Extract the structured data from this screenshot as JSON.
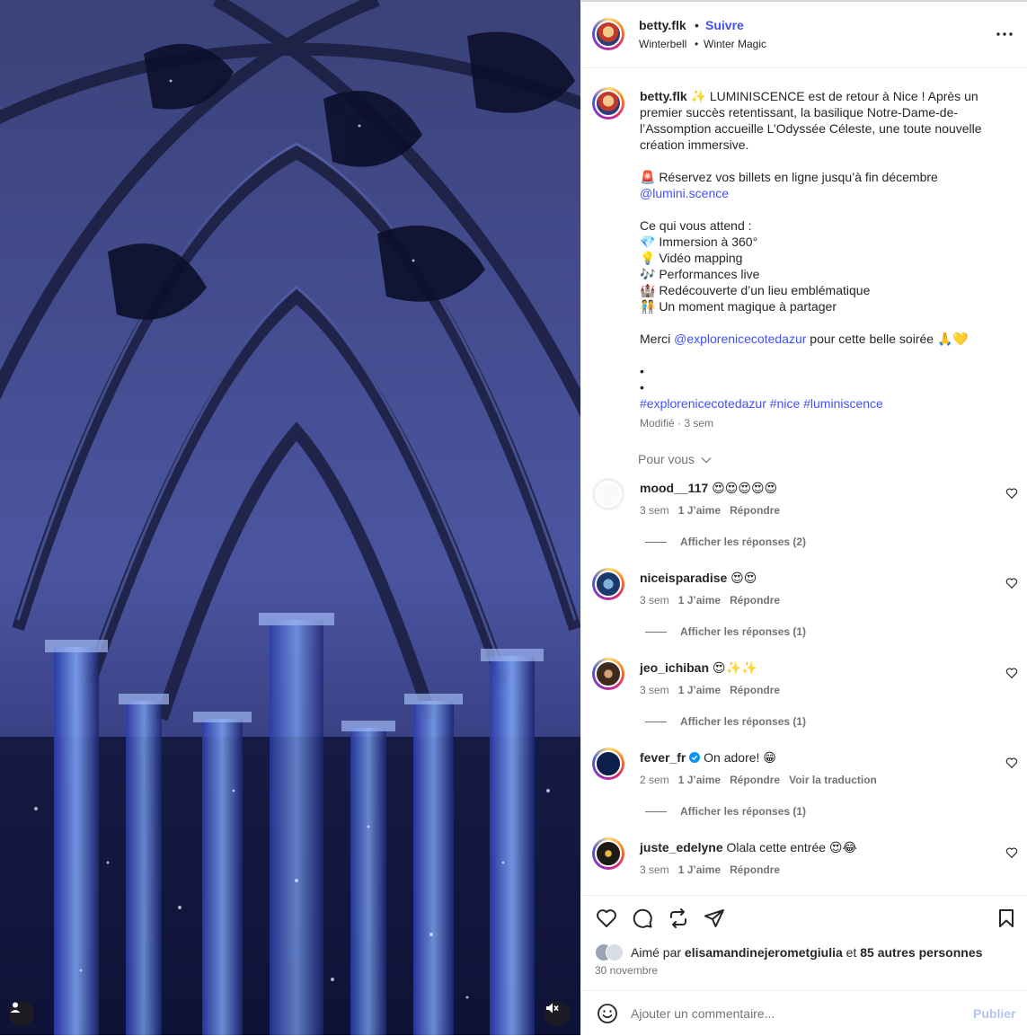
{
  "post": {
    "username": "betty.flk",
    "follow_label": "Suivre",
    "location": "Winterbell",
    "location_sep": "•",
    "audio": "Winter Magic",
    "more_icon": "more-horizontal-icon"
  },
  "caption": {
    "username": "betty.flk",
    "intro": "✨ LUMINISCENCE est de retour à Nice ! Après un premier succès retentissant, la basilique Notre-Dame-de-l’Assomption accueille L’Odyssée Céleste, une toute nouvelle création immersive.",
    "book_line": "🚨 Réservez vos billets en ligne jusqu’à fin décembre",
    "book_mention": "@lumini.scence",
    "expect_title": "Ce qui vous attend :",
    "bullets": [
      "💎 Immersion à 360°",
      "💡 Vidéo mapping",
      "🎶 Performances live",
      "🏰 Redécouverte d’un lieu emblématique",
      "🧑‍🤝‍🧑 Un moment magique à partager"
    ],
    "thanks_prefix": "Merci ",
    "thanks_mention": "@explorenicecotedazur",
    "thanks_suffix": " pour cette belle soirée 🙏💛",
    "dot1": "•",
    "dot2": "•",
    "hashtags": "#explorenicecotedazur #nice #luminiscence",
    "edited": "Modifié · 3 sem"
  },
  "sort_label": "Pour vous",
  "comments": [
    {
      "username": "mood__117",
      "text": "😍😍😍😍😍",
      "time": "3 sem",
      "likes": "1 J’aime",
      "reply": "Répondre",
      "translate": "",
      "replies": "Afficher les réponses (2)"
    },
    {
      "username": "niceisparadise",
      "text": "😍😍",
      "time": "3 sem",
      "likes": "1 J’aime",
      "reply": "Répondre",
      "translate": "",
      "replies": "Afficher les réponses (1)"
    },
    {
      "username": "jeo_ichiban",
      "text": "😍✨✨",
      "time": "3 sem",
      "likes": "1 J’aime",
      "reply": "Répondre",
      "translate": "",
      "replies": "Afficher les réponses (1)"
    },
    {
      "username": "fever_fr",
      "text": "On adore! 😁",
      "time": "2 sem",
      "likes": "1 J’aime",
      "reply": "Répondre",
      "translate": "Voir la traduction",
      "replies": "Afficher les réponses (1)",
      "verified": true
    },
    {
      "username": "juste_edelyne",
      "text": "Olala cette entrée 😍😂",
      "time": "3 sem",
      "likes": "1 J’aime",
      "reply": "Répondre",
      "translate": "",
      "replies": ""
    }
  ],
  "likes_line": {
    "prefix": "Aimé par ",
    "user": "elisamandinejerometgiulia",
    "middle": " et ",
    "others": "85 autres personnes"
  },
  "date": "30 novembre",
  "composer": {
    "placeholder": "Ajouter un commentaire...",
    "publish": "Publier"
  },
  "colors": {
    "accent": "#4150f7",
    "link": "#00376b",
    "muted": "#737373",
    "publish_disabled": "#b2c4f5"
  }
}
